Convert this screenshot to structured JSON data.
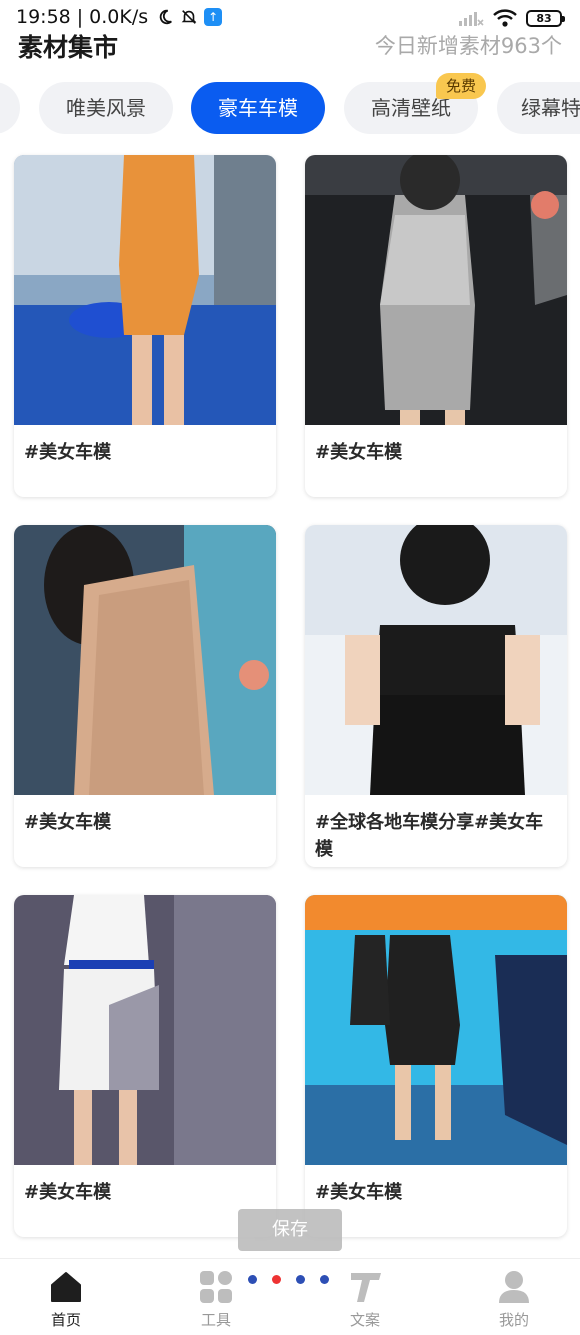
{
  "status_bar": {
    "time": "19:58",
    "separator": "|",
    "net_speed": "0.0K/s",
    "battery": "83"
  },
  "header": {
    "title": "素材集市",
    "today_new": "今日新增素材963个"
  },
  "categories": [
    {
      "label": "唯美风景",
      "active": false
    },
    {
      "label": "豪车车模",
      "active": true
    },
    {
      "label": "高清壁纸",
      "active": false,
      "badge": "免费"
    },
    {
      "label": "绿幕特",
      "active": false
    }
  ],
  "cards": [
    {
      "title": "#美女车模"
    },
    {
      "title": "#美女车模"
    },
    {
      "title": "#美女车模"
    },
    {
      "title": "#全球各地车模分享#美女车模"
    },
    {
      "title": "#美女车模"
    },
    {
      "title": "#美女车模"
    }
  ],
  "toast": {
    "save_label": "保存"
  },
  "bottom_nav": [
    {
      "label": "首页",
      "icon": "home-icon",
      "active": true
    },
    {
      "label": "工具",
      "icon": "grid-icon",
      "active": false
    },
    {
      "label": "文案",
      "icon": "text-icon",
      "active": false
    },
    {
      "label": "我的",
      "icon": "user-icon",
      "active": false
    }
  ],
  "colors": {
    "accent": "#0a5cf0",
    "badge": "#f9c74f",
    "muted": "#a9a9a9"
  }
}
